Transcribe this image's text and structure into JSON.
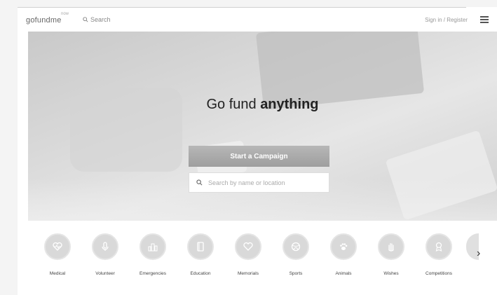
{
  "header": {
    "logo": "gofundme",
    "logo_sup": "now",
    "search_label": "Search",
    "signin_label": "Sign in / Register",
    "menu_icon": "hamburger-menu-icon"
  },
  "hero": {
    "headline_light": "Go fund",
    "headline_bold": "anything",
    "cta_label": "Start a Campaign",
    "search_placeholder": "Search by name or location"
  },
  "categories": [
    {
      "label": "Medical",
      "icon": "heartbeat-icon"
    },
    {
      "label": "Volunteer",
      "icon": "microphone-icon"
    },
    {
      "label": "Emergencies",
      "icon": "city-icon"
    },
    {
      "label": "Education",
      "icon": "book-icon"
    },
    {
      "label": "Memorials",
      "icon": "heart-icon"
    },
    {
      "label": "Sports",
      "icon": "ball-icon"
    },
    {
      "label": "Animals",
      "icon": "paw-icon"
    },
    {
      "label": "Wishes",
      "icon": "hand-icon"
    },
    {
      "label": "Competitions",
      "icon": "award-icon"
    }
  ],
  "colors": {
    "hero_bg": "#d0d0d0",
    "cta_bg": "#a8a8a8",
    "category_circle": "#d9d9d9"
  }
}
